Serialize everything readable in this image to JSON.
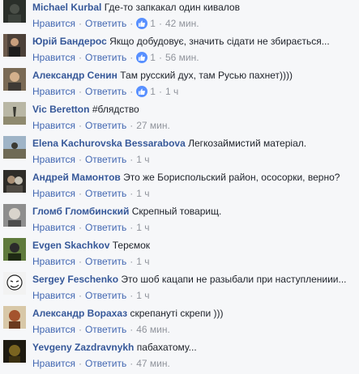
{
  "actions": {
    "like": "Нравится",
    "reply": "Ответить",
    "sep": "·"
  },
  "comments": [
    {
      "author": "Michael Kurbal",
      "text": "Где-то запкакал один кивалов",
      "likes": "1",
      "time": "42 мин.",
      "avatar": "dark"
    },
    {
      "author": "Юрій Бандерос",
      "text": "Якщо добудовує, значить сідати не збирається...",
      "likes": "1",
      "time": "56 мин.",
      "avatar": "person"
    },
    {
      "author": "Александр Сенин",
      "text": "Там русский дух, там Русью пахнет))))",
      "likes": "1",
      "time": "1 ч",
      "avatar": "man"
    },
    {
      "author": "Vic Beretton",
      "text": "#блядство",
      "likes": "",
      "time": "27 мин.",
      "avatar": "landscape"
    },
    {
      "author": "Elena Kachurovska Bessarabova",
      "text": "Легкозаймистий матеріал.",
      "likes": "",
      "time": "1 ч",
      "avatar": "sky"
    },
    {
      "author": "Андрей Мамонтов",
      "text": "Это же Бориспольский район, ососорки, верно?",
      "likes": "",
      "time": "1 ч",
      "avatar": "dark"
    },
    {
      "author": "Гломб Гломбинский",
      "text": "Скрепный товарищ.",
      "likes": "",
      "time": "1 ч",
      "avatar": "face"
    },
    {
      "author": "Evgen Skachkov",
      "text": "Терємок",
      "likes": "",
      "time": "1 ч",
      "avatar": "green"
    },
    {
      "author": "Sergey Feschenko",
      "text": "Это шоб кацапи не разыбали при наступлениии...",
      "likes": "",
      "time": "1 ч",
      "avatar": "meme"
    },
    {
      "author": "Александр Ворахаз",
      "text": "скрепануті скрепи )))",
      "likes": "",
      "time": "46 мин.",
      "avatar": "warm"
    },
    {
      "author": "Yevgeny Zazdravnykh",
      "text": "пабахатому...",
      "likes": "",
      "time": "47 мин.",
      "avatar": "night"
    }
  ]
}
